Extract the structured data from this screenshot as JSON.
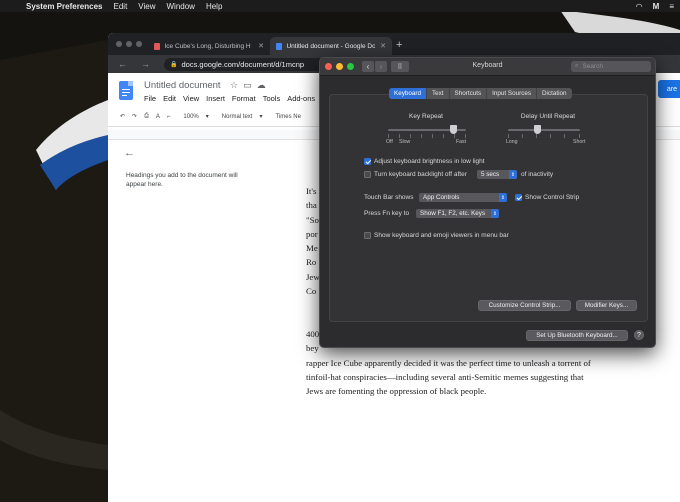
{
  "menubar": {
    "app": "System Preferences",
    "items": [
      "Edit",
      "View",
      "Window",
      "Help"
    ],
    "status_letter": "M"
  },
  "chrome": {
    "tabs": [
      {
        "label": "Ice Cube's Long, Disturbing H",
        "favicon_color": "#e05757"
      },
      {
        "label": "Untitled document - Google Do",
        "favicon_color": "#4285f4"
      }
    ],
    "url": "docs.google.com/document/d/1mcnp"
  },
  "docs": {
    "title": "Untitled document",
    "menu": [
      "File",
      "Edit",
      "View",
      "Insert",
      "Format",
      "Tools",
      "Add-ons"
    ],
    "share": "are",
    "zoom": "100%",
    "style": "Normal text",
    "font": "Times Ne",
    "outline_hint": "Headings you add to the document will appear here.",
    "para1_lines": [
      "It's",
      "tha",
      "\"So",
      "por",
      "Me",
      "Ro",
      "Jew",
      "Co"
    ],
    "para2_lines": [
      "400",
      "bey",
      "rapper Ice Cube apparently decided it was the perfect time to unleash a torrent of",
      "tinfoil-hat conspiracies—including several anti-Semitic memes suggesting that",
      "Jews are fomenting the oppression of black people."
    ]
  },
  "keyboard_prefs": {
    "window_title": "Keyboard",
    "search_placeholder": "Search",
    "tabs": [
      "Keyboard",
      "Text",
      "Shortcuts",
      "Input Sources",
      "Dictation"
    ],
    "selected_tab": "Keyboard",
    "key_repeat": {
      "title": "Key Repeat",
      "labels": [
        "Off",
        "Slow",
        "Fast"
      ],
      "position": 0.85
    },
    "delay_until_repeat": {
      "title": "Delay Until Repeat",
      "labels": [
        "Long",
        "Short"
      ],
      "position": 0.4
    },
    "adjust_brightness": {
      "label": "Adjust keyboard brightness in low light",
      "checked": true
    },
    "backlight_off": {
      "label": "Turn keyboard backlight off after",
      "checked": false,
      "value": "5 secs",
      "suffix": "of inactivity"
    },
    "touch_bar_shows": {
      "label": "Touch Bar shows",
      "value": "App Controls"
    },
    "show_control_strip": {
      "label": "Show Control Strip",
      "checked": true
    },
    "press_fn": {
      "label": "Press Fn key to",
      "value": "Show F1, F2, etc. Keys"
    },
    "show_viewers": {
      "label": "Show keyboard and emoji viewers in menu bar",
      "checked": false
    },
    "customize_button": "Customize Control Strip...",
    "modifier_button": "Modifier Keys...",
    "bluetooth_button": "Set Up Bluetooth Keyboard...",
    "help": "?"
  }
}
